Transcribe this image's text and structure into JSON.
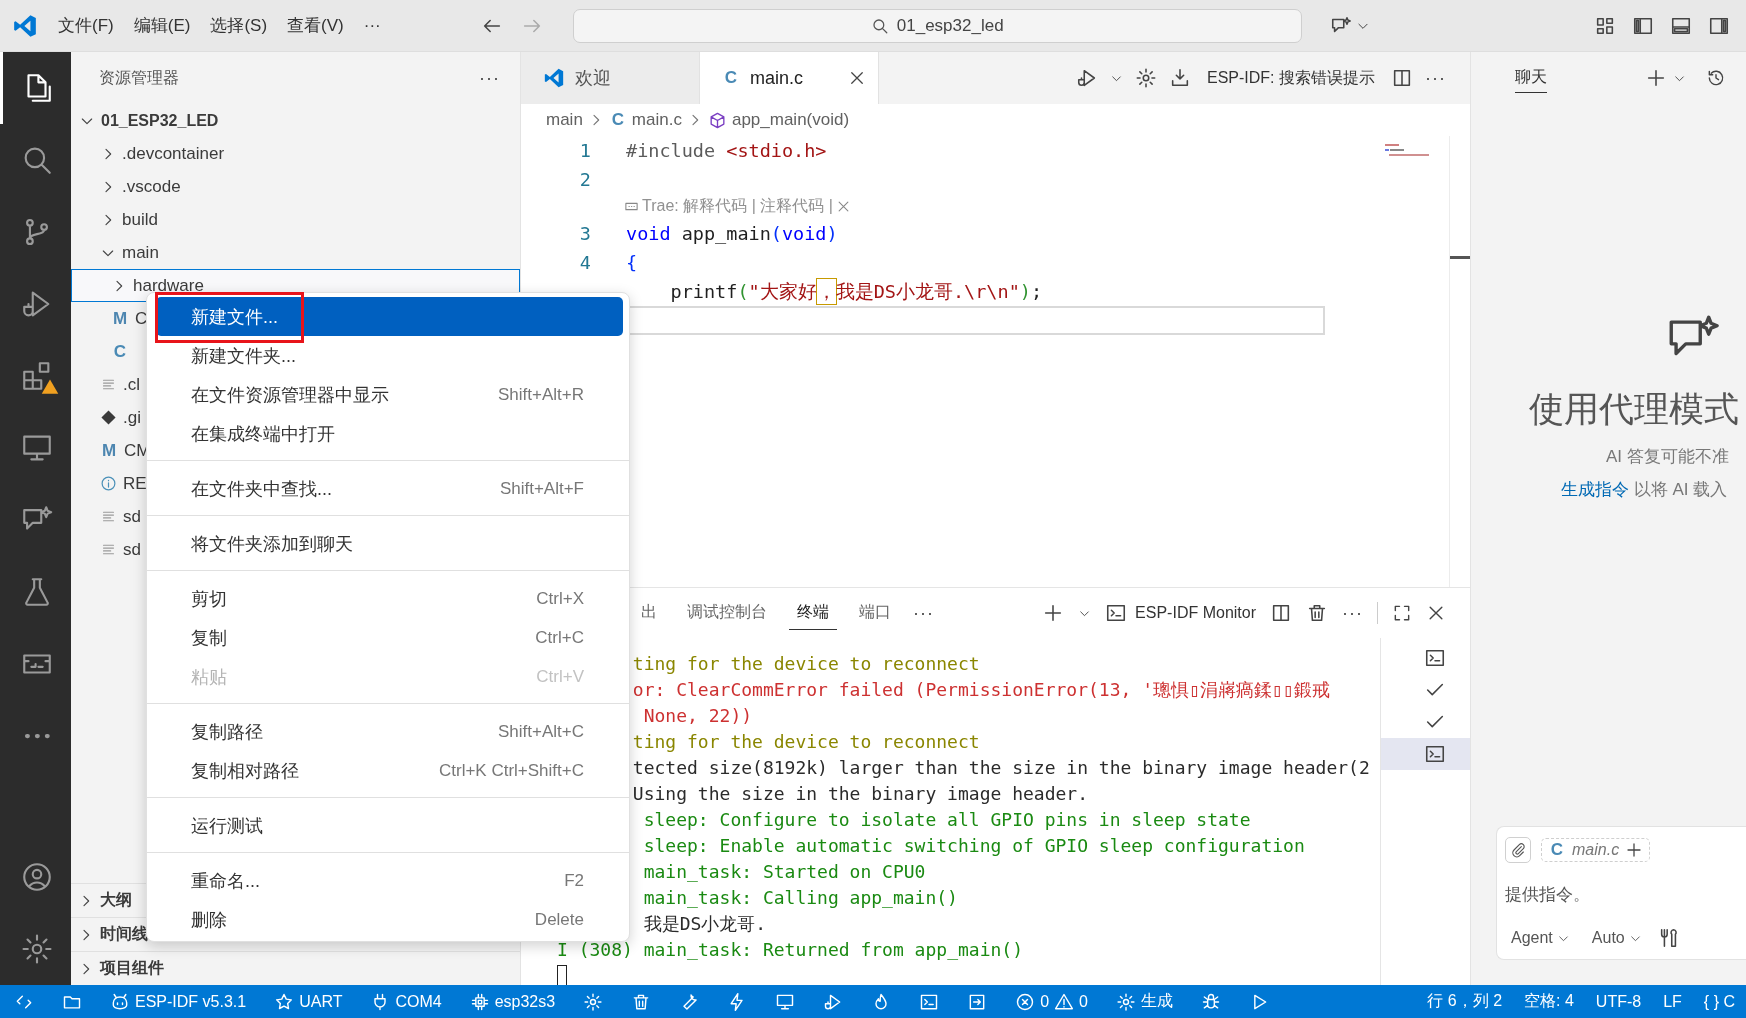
{
  "title_bar": {
    "menus": [
      "文件(F)",
      "编辑(E)",
      "选择(S)",
      "查看(V)"
    ],
    "more": "···",
    "search": "01_esp32_led"
  },
  "activity_bar": {
    "items": [
      {
        "kind": "files",
        "selected": true,
        "warning": false
      },
      {
        "kind": "search",
        "selected": false,
        "warning": false
      },
      {
        "kind": "source-control",
        "selected": false,
        "warning": false
      },
      {
        "kind": "run-debug",
        "selected": false,
        "warning": false
      },
      {
        "kind": "extensions",
        "selected": false,
        "warning": true
      },
      {
        "kind": "monitor",
        "selected": false,
        "warning": false
      },
      {
        "kind": "chat",
        "selected": false,
        "warning": false
      },
      {
        "kind": "flask",
        "selected": false,
        "warning": false
      },
      {
        "kind": "board",
        "selected": false,
        "warning": false
      },
      {
        "kind": "more",
        "selected": false,
        "warning": false
      }
    ],
    "bottom": [
      {
        "kind": "account",
        "selected": false,
        "warning": false
      },
      {
        "kind": "settings",
        "selected": false,
        "warning": false
      }
    ]
  },
  "explorer": {
    "title": "资源管理器",
    "more": "···",
    "tree": {
      "label": "01_ESP32_LED",
      "expanded": true,
      "selected": false,
      "children": [
        {
          "kind": "folder",
          "label": ".devcontainer",
          "expanded": false,
          "selected": false
        },
        {
          "kind": "folder",
          "label": ".vscode",
          "expanded": false,
          "selected": false
        },
        {
          "kind": "folder",
          "label": "build",
          "expanded": false,
          "selected": false
        },
        {
          "kind": "folder",
          "label": "main",
          "expanded": true,
          "selected": false,
          "children": [
            {
              "kind": "folder",
              "label": "hardware",
              "expanded": false,
              "selected": true
            },
            {
              "kind": "cmake",
              "icon_text": "M",
              "label": "C",
              "selected": false
            },
            {
              "kind": "c",
              "icon_text": "C",
              "selected": false
            }
          ]
        },
        {
          "kind": "text",
          "label": ".cl",
          "selected": false
        },
        {
          "kind": "git",
          "label": ".gi",
          "selected": false
        },
        {
          "kind": "cmake",
          "icon_text": "M",
          "label": "CM",
          "selected": false
        },
        {
          "kind": "info",
          "label": "RE",
          "selected": false
        },
        {
          "kind": "text",
          "label": "sd",
          "selected": false
        },
        {
          "kind": "text",
          "label": "sd",
          "selected": false
        }
      ]
    },
    "sections": [
      {
        "label": "大纲",
        "expanded": false
      },
      {
        "label": "时间线",
        "expanded": false
      },
      {
        "label": "项目组件",
        "expanded": false
      }
    ]
  },
  "editor": {
    "tabs": [
      {
        "kind": "welcome",
        "label": "欢迎",
        "selected": false
      },
      {
        "kind": "c",
        "icon_text": "C",
        "label": "main.c",
        "selected": true
      }
    ],
    "toolbar_label": "ESP-IDF: 搜索错误提示",
    "breadcrumb": [
      {
        "kind": "folder",
        "label": "main"
      },
      {
        "kind": "c",
        "icon_text": "C",
        "label": "main.c"
      },
      {
        "kind": "symbol",
        "label": "app_main(void)"
      }
    ],
    "lines": [
      {
        "kind": "code",
        "number": "1",
        "current": false,
        "tokens": [
          {
            "kind": "directive",
            "text": "#include "
          },
          {
            "kind": "string",
            "text": "<stdio.h>"
          }
        ]
      },
      {
        "kind": "code",
        "number": "2",
        "current": false
      },
      {
        "kind": "lens",
        "text": "Trae: 解释代码 | 注释代码 |"
      },
      {
        "kind": "code",
        "number": "3",
        "current": false,
        "tokens": [
          {
            "kind": "keyword",
            "text": "void"
          },
          {
            "kind": "plain",
            "text": " app_main"
          },
          {
            "kind": "bracket1",
            "text": "("
          },
          {
            "kind": "keyword",
            "text": "void"
          },
          {
            "kind": "bracket1",
            "text": ")"
          }
        ]
      },
      {
        "kind": "code",
        "number": "4",
        "current": false,
        "tokens": [
          {
            "kind": "bracket1",
            "text": "{"
          }
        ]
      },
      {
        "kind": "code",
        "current": false,
        "tokens": [
          {
            "kind": "plain",
            "text": "    printf"
          },
          {
            "kind": "bracket2",
            "text": "("
          },
          {
            "kind": "string",
            "text": "\"大家好"
          },
          {
            "kind": "string",
            "text": "，",
            "flagged": true
          },
          {
            "kind": "string",
            "text": "我是DS小龙哥.\\r\\n\""
          },
          {
            "kind": "bracket2",
            "text": ")"
          },
          {
            "kind": "plain",
            "text": ";"
          }
        ]
      },
      {
        "kind": "code",
        "current": true
      }
    ]
  },
  "panel": {
    "tabs": [
      {
        "label": "出",
        "selected": false
      },
      {
        "label": "调试控制台",
        "selected": false
      },
      {
        "label": "终端",
        "selected": true
      },
      {
        "label": "端口",
        "selected": false
      }
    ],
    "more": "···",
    "terminal_name": "ESP-IDF Monitor",
    "actions_more": "···",
    "lines": [
      {
        "kind": "warning",
        "truncated": true,
        "text": "ting for the device to reconnect"
      },
      {
        "kind": "error",
        "truncated": true,
        "text": "or: ClearCommError failed (PermissionError(13, '璁惧▯涓嶈瘑鍒▯▯鍛戒"
      },
      {
        "kind": "error",
        "truncated": true,
        "text": " None, 22))"
      },
      {
        "kind": "warning",
        "truncated": true,
        "text": "ting for the device to reconnect"
      },
      {
        "kind": "plain",
        "truncated": true,
        "text": "tected size(8192k) larger than the size in the binary image header(2"
      },
      {
        "kind": "plain",
        "truncated": true,
        "text": "Using the size in the binary image header."
      },
      {
        "kind": "info",
        "truncated": true,
        "text": " sleep: Configure to isolate all GPIO pins in sleep state"
      },
      {
        "kind": "info",
        "truncated": true,
        "text": " sleep: Enable automatic switching of GPIO sleep configuration"
      },
      {
        "kind": "info",
        "truncated": true,
        "text": " main_task: Started on CPU0"
      },
      {
        "kind": "info",
        "truncated": true,
        "text": " main_task: Calling app_main()"
      },
      {
        "kind": "plain",
        "truncated": true,
        "text": " 我是DS小龙哥."
      },
      {
        "kind": "info",
        "truncated": false,
        "text": "I (308) main_task: Returned from app_main()"
      }
    ],
    "terminals": [
      {
        "kind": "terminal",
        "selected": false
      },
      {
        "kind": "check",
        "selected": false
      },
      {
        "kind": "check",
        "selected": false
      },
      {
        "kind": "terminal",
        "selected": true
      }
    ]
  },
  "context_menu": {
    "groups": [
      {
        "items": [
          {
            "label": "新建文件...",
            "selected": true,
            "disabled": false
          },
          {
            "label": "新建文件夹...",
            "selected": false,
            "disabled": false
          },
          {
            "label": "在文件资源管理器中显示",
            "shortcut": "Shift+Alt+R",
            "selected": false,
            "disabled": false
          },
          {
            "label": "在集成终端中打开",
            "selected": false,
            "disabled": false
          }
        ]
      },
      {
        "items": [
          {
            "label": "在文件夹中查找...",
            "shortcut": "Shift+Alt+F",
            "selected": false,
            "disabled": false
          }
        ]
      },
      {
        "items": [
          {
            "label": "将文件夹添加到聊天",
            "selected": false,
            "disabled": false
          }
        ]
      },
      {
        "items": [
          {
            "label": "剪切",
            "shortcut": "Ctrl+X",
            "selected": false,
            "disabled": false
          },
          {
            "label": "复制",
            "shortcut": "Ctrl+C",
            "selected": false,
            "disabled": false
          },
          {
            "label": "粘贴",
            "shortcut": "Ctrl+V",
            "selected": false,
            "disabled": true
          }
        ]
      },
      {
        "items": [
          {
            "label": "复制路径",
            "shortcut": "Shift+Alt+C",
            "selected": false,
            "disabled": false
          },
          {
            "label": "复制相对路径",
            "shortcut": "Ctrl+K Ctrl+Shift+C",
            "selected": false,
            "disabled": false
          }
        ]
      },
      {
        "items": [
          {
            "label": "运行测试",
            "selected": false,
            "disabled": false
          }
        ]
      },
      {
        "items": [
          {
            "label": "重命名...",
            "shortcut": "F2",
            "selected": false,
            "disabled": false
          },
          {
            "label": "删除",
            "shortcut": "Delete",
            "selected": false,
            "disabled": false
          }
        ]
      }
    ]
  },
  "chat": {
    "tab": {
      "label": "聊天",
      "selected": true
    },
    "heading": "使用代理模式",
    "disclaimer": "AI 答复可能不准",
    "link": "生成指令",
    "link_rest": " 以将 AI 载入",
    "input": {
      "chip_icon_text": "C",
      "chip": "main.c",
      "placeholder": "提供指令。",
      "mode": "Agent",
      "model": "Auto"
    }
  },
  "status_bar": {
    "left": [
      {
        "kind": "remote"
      },
      {
        "kind": "window"
      },
      {
        "kind": "robot",
        "text": "ESP-IDF v5.3.1"
      },
      {
        "kind": "star",
        "text": "UART"
      },
      {
        "kind": "plug",
        "text": "COM4"
      },
      {
        "kind": "chip",
        "text": "esp32s3"
      },
      {
        "kind": "settings"
      },
      {
        "kind": "trash"
      },
      {
        "kind": "wrench"
      },
      {
        "kind": "flash"
      },
      {
        "kind": "monitor"
      },
      {
        "kind": "run-debug"
      },
      {
        "kind": "flame"
      },
      {
        "kind": "terminal"
      },
      {
        "kind": "arrow-box"
      },
      {
        "kind": "problems",
        "errors": "0",
        "warnings": "0"
      },
      {
        "kind": "settings",
        "text": "生成"
      },
      {
        "kind": "bug"
      },
      {
        "kind": "play"
      }
    ],
    "right": [
      "行 6，列 2",
      "空格: 4",
      "UTF-8",
      "LF",
      "{ } C"
    ]
  }
}
